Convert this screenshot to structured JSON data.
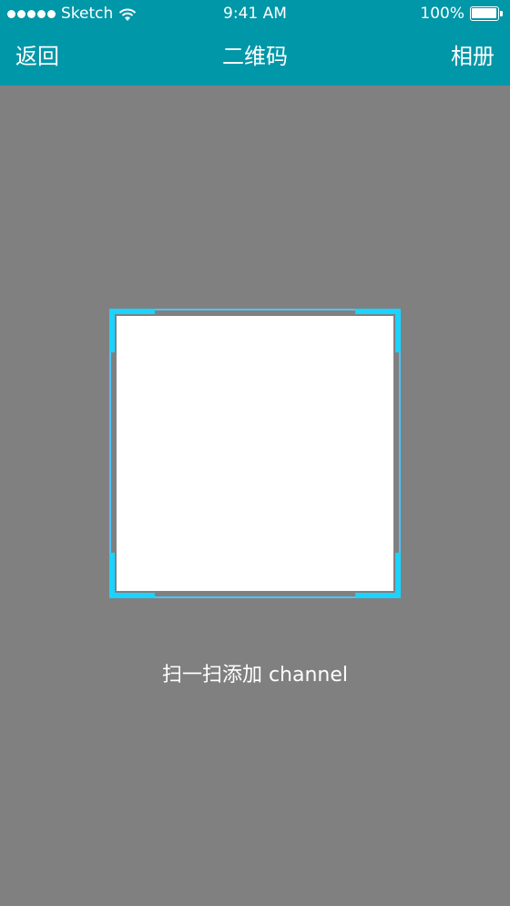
{
  "status_bar": {
    "carrier": "Sketch",
    "time": "9:41 AM",
    "battery": "100%",
    "signal_icon": "signal-dots-icon",
    "wifi_icon": "wifi-icon",
    "battery_icon": "battery-icon"
  },
  "nav": {
    "back_label": "返回",
    "title": "二维码",
    "album_label": "相册"
  },
  "scanner": {
    "hint": "扫一扫添加 channel"
  },
  "colors": {
    "header_bg": "#0097a8",
    "page_bg": "#808080",
    "corner_accent": "#1ad3ff"
  }
}
